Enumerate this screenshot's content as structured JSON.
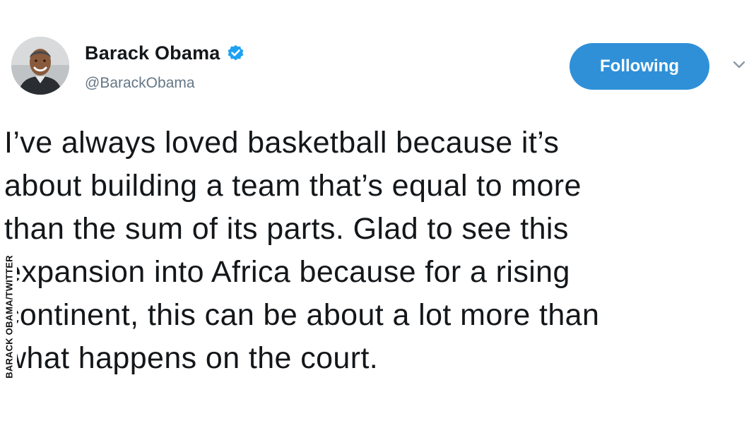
{
  "tweet": {
    "author": {
      "display_name": "Barack Obama",
      "handle": "@BarackObama",
      "verified": true
    },
    "follow_button_label": "Following",
    "text_lines": [
      "I’ve always loved basketball because it’s",
      "about building a team that’s equal to more",
      "than the sum of its parts. Glad to see this",
      "expansion into Africa because for a rising",
      "continent, this can be about a lot more than",
      "what happens on the court."
    ]
  },
  "watermark": {
    "text": "BARACK OBAMA/TWITTER"
  },
  "colors": {
    "follow_button": "#2f90d8",
    "verified_badge": "#1da1f2",
    "handle": "#657786",
    "text": "#14171a"
  },
  "icons": {
    "avatar": "profile-photo",
    "verified": "verified-badge-icon",
    "menu": "chevron-down-icon"
  }
}
